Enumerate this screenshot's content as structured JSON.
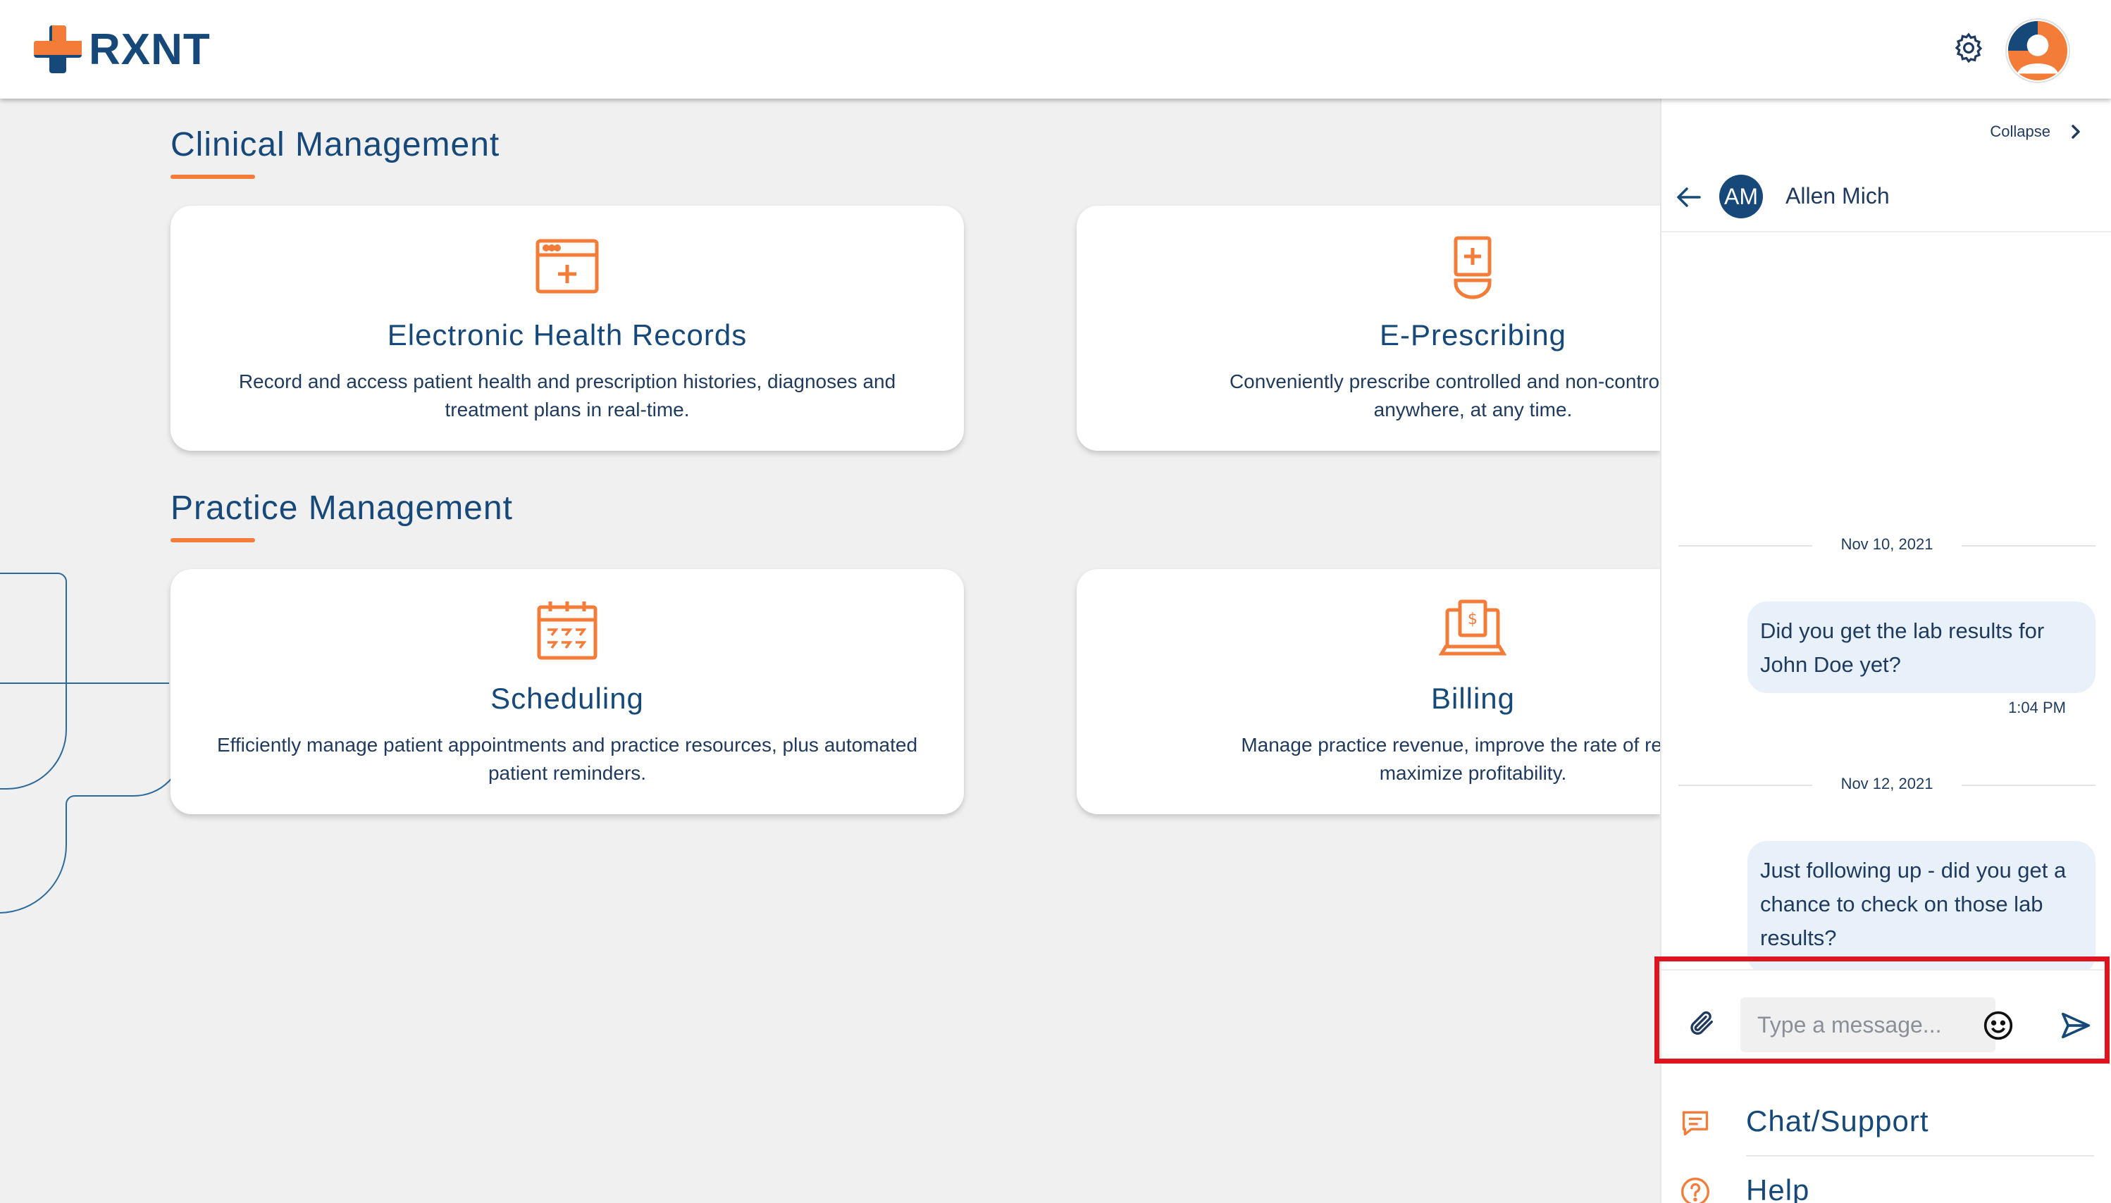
{
  "app": {
    "logo_text": "RXNT"
  },
  "header": {
    "settings_icon": "gear-icon",
    "profile_icon": "user-avatar"
  },
  "sections": [
    {
      "title": "Clinical Management",
      "cards": [
        {
          "title": "Electronic Health Records",
          "description": "Record and access patient health and prescription histories, diagnoses and treatment plans in real-time.",
          "icon": "ehr-window-icon"
        },
        {
          "title": "E-Prescribing",
          "description": "Conveniently prescribe controlled and non-controlled su\nanywhere, at any time.",
          "icon": "prescription-bottle-icon"
        }
      ]
    },
    {
      "title": "Practice Management",
      "cards": [
        {
          "title": "Scheduling",
          "description": "Efficiently manage patient appointments and practice resources, plus automated patient reminders.",
          "icon": "calendar-icon"
        },
        {
          "title": "Billing",
          "description": "Manage practice revenue, improve the rate of reimbu\nmaximize profitability.",
          "icon": "billing-computer-icon"
        }
      ]
    }
  ],
  "chat_panel": {
    "collapse_label": "Collapse",
    "contact": {
      "initials": "AM",
      "name": "Allen Mich"
    },
    "messages": [
      {
        "date": "Nov 10, 2021",
        "text": "Did you get the lab results for John Doe yet?",
        "time": "1:04 PM"
      },
      {
        "date": "Nov 12, 2021",
        "text": "Just following up - did you get a chance to check on those lab results?"
      }
    ],
    "input_placeholder": "Type a message...",
    "menu": [
      {
        "label": "Chat/Support",
        "icon": "chat-icon"
      },
      {
        "label": "Help",
        "icon": "help-icon"
      }
    ]
  },
  "colors": {
    "brand_blue": "#16497a",
    "accent_orange": "#f27c38",
    "highlight_red": "#e0141f"
  }
}
